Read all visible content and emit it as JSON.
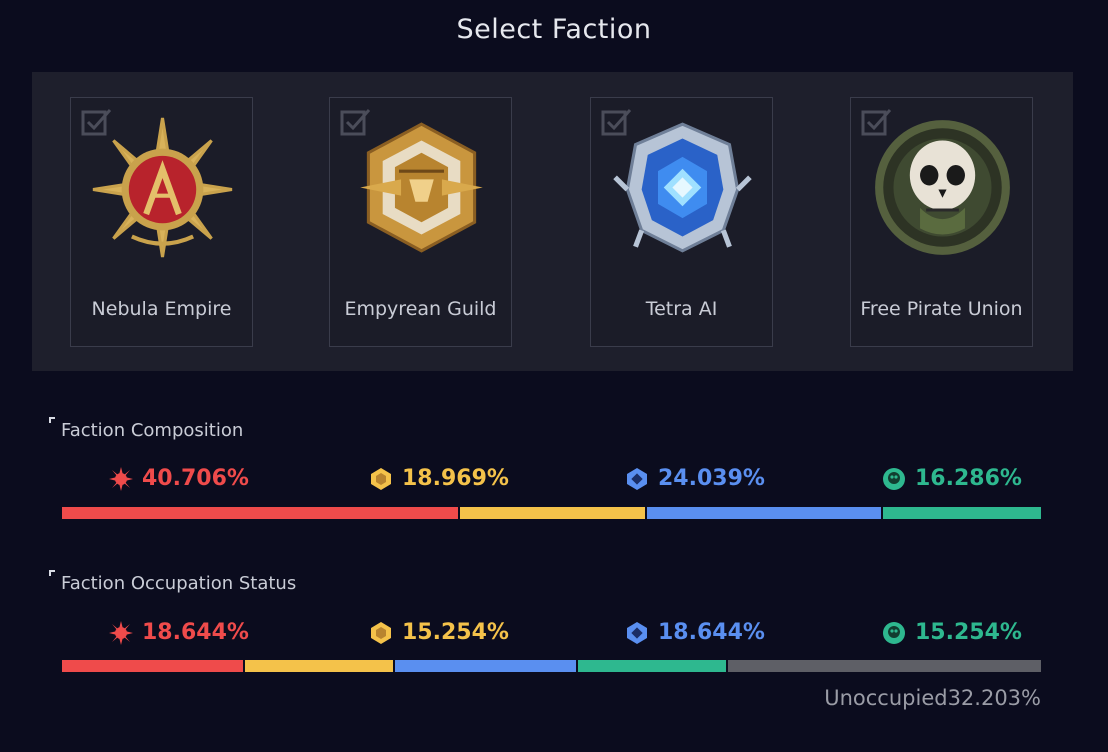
{
  "title": "Select Faction",
  "factions": [
    {
      "name": "Nebula Empire",
      "color": "#ef4b4b",
      "icon": "nebula-empire-emblem"
    },
    {
      "name": "Empyrean Guild",
      "color": "#f4c24a",
      "icon": "empyrean-guild-emblem"
    },
    {
      "name": "Tetra AI",
      "color": "#5a8ff0",
      "icon": "tetra-ai-emblem"
    },
    {
      "name": "Free Pirate Union",
      "color": "#2eb88f",
      "icon": "free-pirate-union-emblem"
    }
  ],
  "composition": {
    "label": "Faction Composition",
    "values": [
      "40.706%",
      "18.969%",
      "24.039%",
      "16.286%"
    ],
    "fractions": [
      0.40706,
      0.18969,
      0.24039,
      0.16286
    ]
  },
  "occupation": {
    "label": "Faction Occupation Status",
    "values": [
      "18.644%",
      "15.254%",
      "18.644%",
      "15.254%"
    ],
    "fractions": [
      0.18644,
      0.15254,
      0.18644,
      0.15254
    ],
    "unoccupied_label": "Unoccupied32.203%",
    "unoccupied_fraction": 0.32203,
    "unoccupied_color": "#5e5f66"
  }
}
